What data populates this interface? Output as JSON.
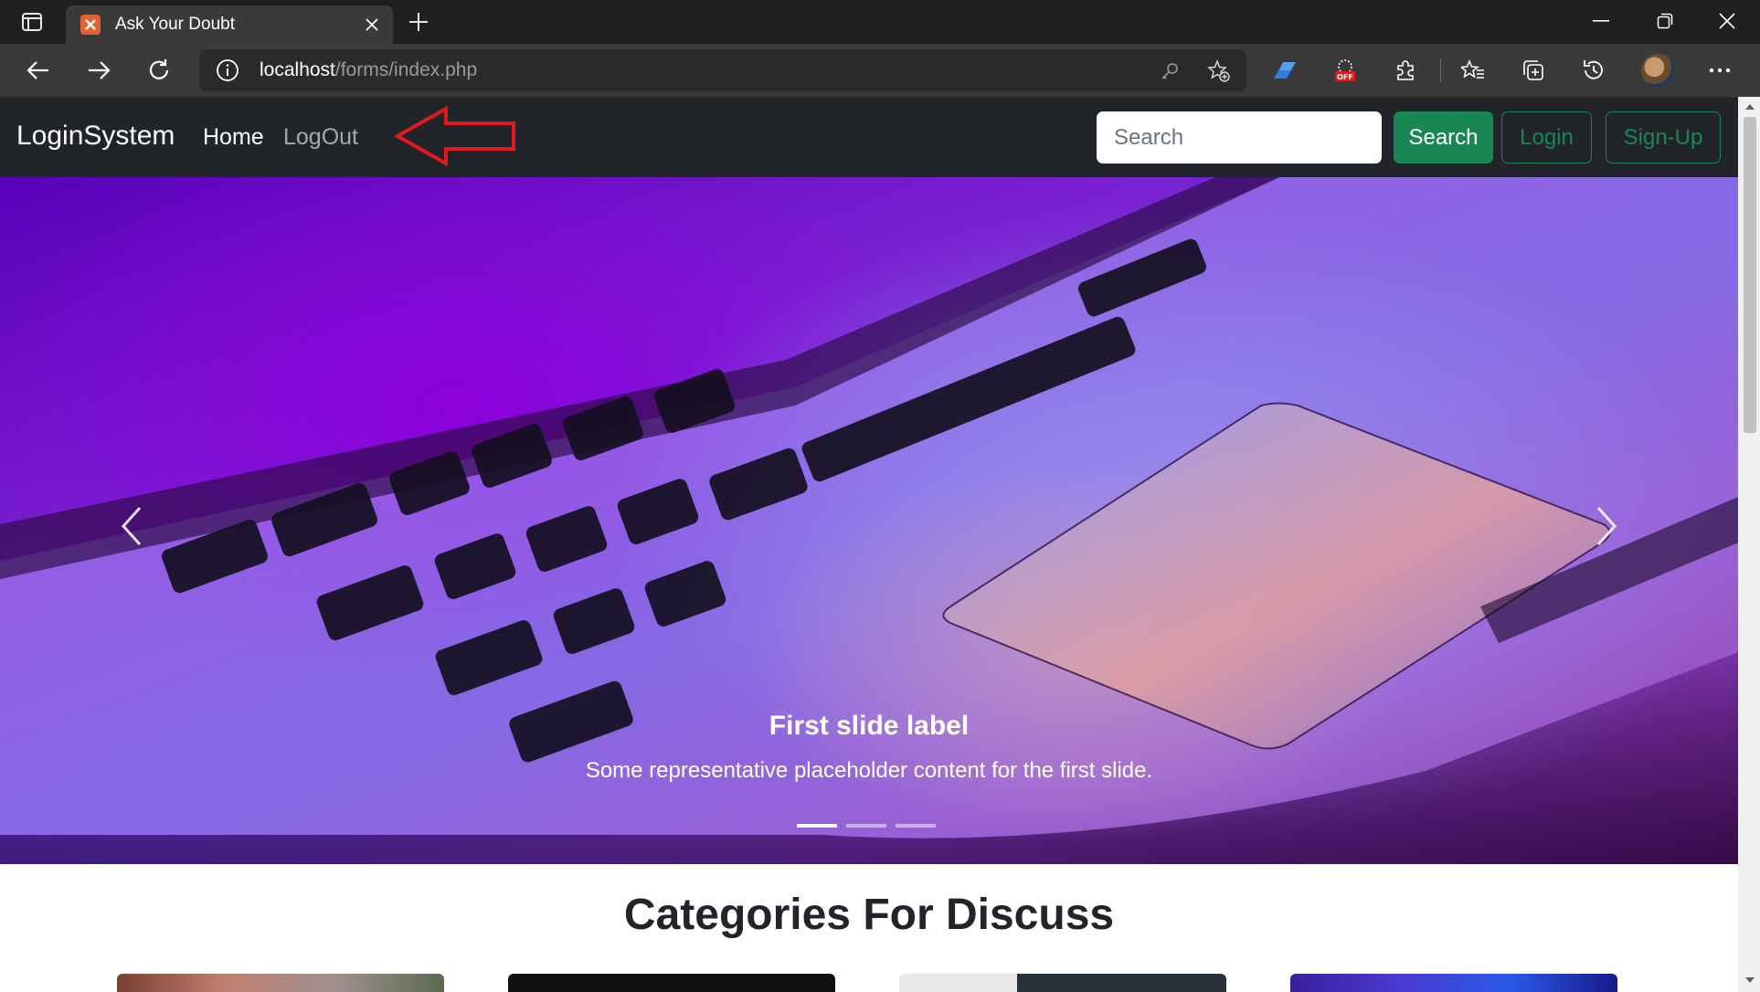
{
  "browser": {
    "tab_title": "Ask Your Doubt",
    "tab_favicon_text": "'",
    "url_host": "localhost",
    "url_path": "/forms/index.php"
  },
  "navbar": {
    "brand": "LoginSystem",
    "home_label": "Home",
    "logout_label": "LogOut",
    "search_placeholder": "Search",
    "search_button": "Search",
    "login_button": "Login",
    "signup_button": "Sign-Up"
  },
  "carousel": {
    "title": "First slide label",
    "text": "Some representative placeholder content for the first slide.",
    "indicators": 3,
    "active_index": 0
  },
  "section": {
    "title": "Categories For Discuss"
  },
  "colors": {
    "navbar_bg": "#212529",
    "success": "#198754",
    "annotation_arrow": "#e0191e"
  }
}
